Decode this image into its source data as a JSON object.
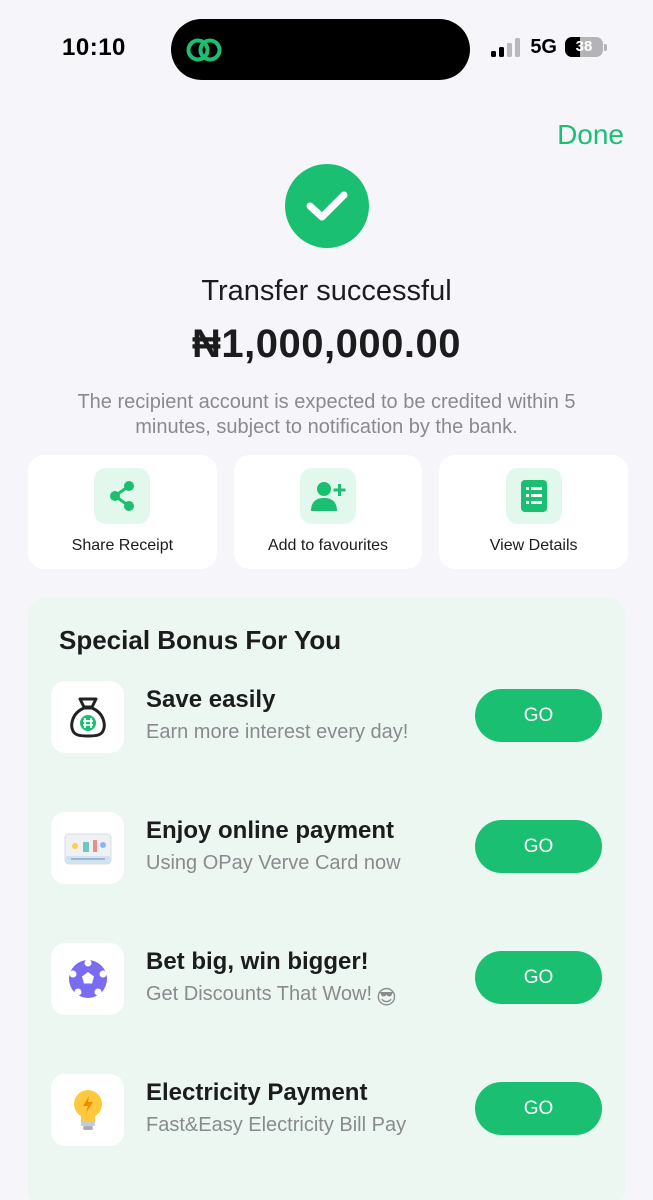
{
  "status_bar": {
    "time": "10:10",
    "network": "5G",
    "battery": "38"
  },
  "header": {
    "done_label": "Done"
  },
  "result": {
    "title": "Transfer successful",
    "amount": "₦1,000,000.00",
    "note": "The recipient account is expected to be credited within 5 minutes, subject to notification by the bank."
  },
  "actions": [
    {
      "label": "Share Receipt",
      "icon": "share-icon"
    },
    {
      "label": "Add to favourites",
      "icon": "add-user-icon"
    },
    {
      "label": "View Details",
      "icon": "document-icon"
    }
  ],
  "bonus": {
    "title": "Special Bonus For You",
    "items": [
      {
        "name": "Save easily",
        "desc": "Earn more interest every day!",
        "button": "GO",
        "icon": "money-bag-icon"
      },
      {
        "name": "Enjoy online payment",
        "desc": "Using OPay Verve Card now",
        "button": "GO",
        "icon": "card-icon"
      },
      {
        "name": "Bet big, win bigger!",
        "desc": "Get Discounts That Wow!",
        "button": "GO",
        "icon": "soccer-ball-icon",
        "emoji": "😎"
      },
      {
        "name": "Electricity Payment",
        "desc": "Fast&Easy Electricity Bill Pay",
        "button": "GO",
        "icon": "lightbulb-icon"
      }
    ]
  },
  "colors": {
    "accent": "#1bbf72",
    "background": "#f6f6fa",
    "bonus_background": "#ebf7f0"
  }
}
